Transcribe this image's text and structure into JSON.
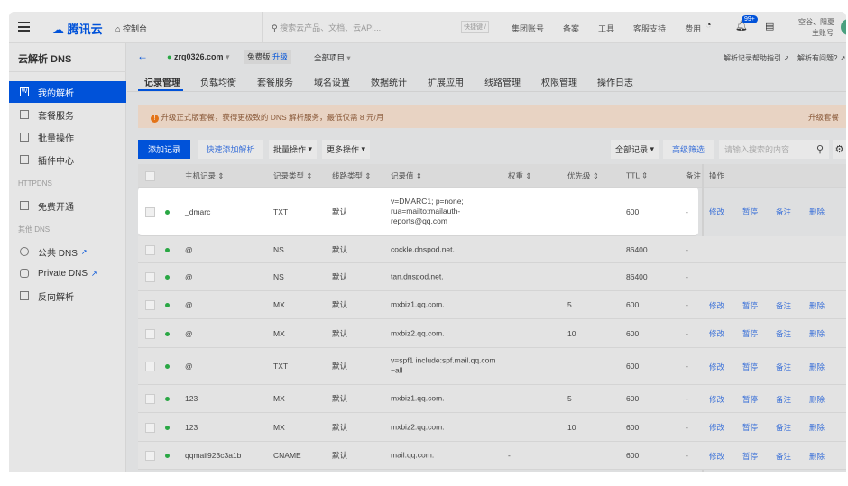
{
  "topbar": {
    "logo": "腾讯云",
    "console": "控制台",
    "search_placeholder": "搜索云产品、文档、云API...",
    "shortcut": "快捷键 /",
    "links": [
      "集团账号",
      "备案",
      "工具",
      "客服支持",
      "费用"
    ],
    "badge": "99+",
    "user_name": "空谷、阳夏",
    "user_role": "主账号"
  },
  "sidebar": {
    "title": "云解析 DNS",
    "items": [
      {
        "label": "我的解析",
        "active": true
      },
      {
        "label": "套餐服务"
      },
      {
        "label": "批量操作"
      },
      {
        "label": "插件中心"
      }
    ],
    "group1": "HTTPDNS",
    "group1_items": [
      {
        "label": "免费开通"
      }
    ],
    "group2": "其他 DNS",
    "group2_items": [
      {
        "label": "公共 DNS"
      },
      {
        "label": "Private DNS"
      },
      {
        "label": "反向解析"
      }
    ]
  },
  "header": {
    "domain": "zrq0326.com",
    "plan": "免费版",
    "upgrade": "升级",
    "project": "全部项目",
    "help1": "解析记录帮助指引",
    "help2": "解析有问题?"
  },
  "tabs": [
    "记录管理",
    "负载均衡",
    "套餐服务",
    "域名设置",
    "数据统计",
    "扩展应用",
    "线路管理",
    "权限管理",
    "操作日志"
  ],
  "banner": {
    "text": "升级正式版套餐，获得更极致的 DNS 解析服务，最低仅需 8 元/月",
    "action": "升级套餐"
  },
  "toolbar": {
    "add": "添加记录",
    "quick_add": "快速添加解析",
    "batch": "批量操作",
    "more": "更多操作",
    "filter": "全部记录",
    "advanced": "高级筛选",
    "search_placeholder": "请输入搜索的内容"
  },
  "table": {
    "headers": [
      "主机记录",
      "记录类型",
      "线路类型",
      "记录值",
      "权重",
      "优先级",
      "TTL",
      "备注",
      "操作"
    ],
    "actions": [
      "修改",
      "暂停",
      "备注",
      "删除"
    ],
    "rows": [
      {
        "host": "_dmarc",
        "type": "TXT",
        "line": "默认",
        "value": "v=DMARC1; p=none;\nrua=mailto:mailauth-\nreports@qq.com",
        "weight": "",
        "priority": "",
        "ttl": "600",
        "remark": "-",
        "ops": true
      },
      {
        "host": "@",
        "type": "NS",
        "line": "默认",
        "value": "cockle.dnspod.net.",
        "weight": "",
        "priority": "",
        "ttl": "86400",
        "remark": "-",
        "ops": false
      },
      {
        "host": "@",
        "type": "NS",
        "line": "默认",
        "value": "tan.dnspod.net.",
        "weight": "",
        "priority": "",
        "ttl": "86400",
        "remark": "-",
        "ops": false
      },
      {
        "host": "@",
        "type": "MX",
        "line": "默认",
        "value": "mxbiz1.qq.com.",
        "weight": "",
        "priority": "5",
        "ttl": "600",
        "remark": "-",
        "ops": true
      },
      {
        "host": "@",
        "type": "MX",
        "line": "默认",
        "value": "mxbiz2.qq.com.",
        "weight": "",
        "priority": "10",
        "ttl": "600",
        "remark": "-",
        "ops": true
      },
      {
        "host": "@",
        "type": "TXT",
        "line": "默认",
        "value": "v=spf1 include:spf.mail.qq.com\n~all",
        "weight": "",
        "priority": "",
        "ttl": "600",
        "remark": "-",
        "ops": true
      },
      {
        "host": "123",
        "type": "MX",
        "line": "默认",
        "value": "mxbiz1.qq.com.",
        "weight": "",
        "priority": "5",
        "ttl": "600",
        "remark": "-",
        "ops": true
      },
      {
        "host": "123",
        "type": "MX",
        "line": "默认",
        "value": "mxbiz2.qq.com.",
        "weight": "",
        "priority": "10",
        "ttl": "600",
        "remark": "-",
        "ops": true
      },
      {
        "host": "qqmail923c3a1b",
        "type": "CNAME",
        "line": "默认",
        "value": "mail.qq.com.",
        "weight": "-",
        "priority": "",
        "ttl": "600",
        "remark": "-",
        "ops": true
      }
    ]
  },
  "colors": {
    "primary": "#0052d9",
    "status_ok": "#29a744",
    "banner_bg": "#e8d3c3",
    "warn": "#e37318"
  }
}
